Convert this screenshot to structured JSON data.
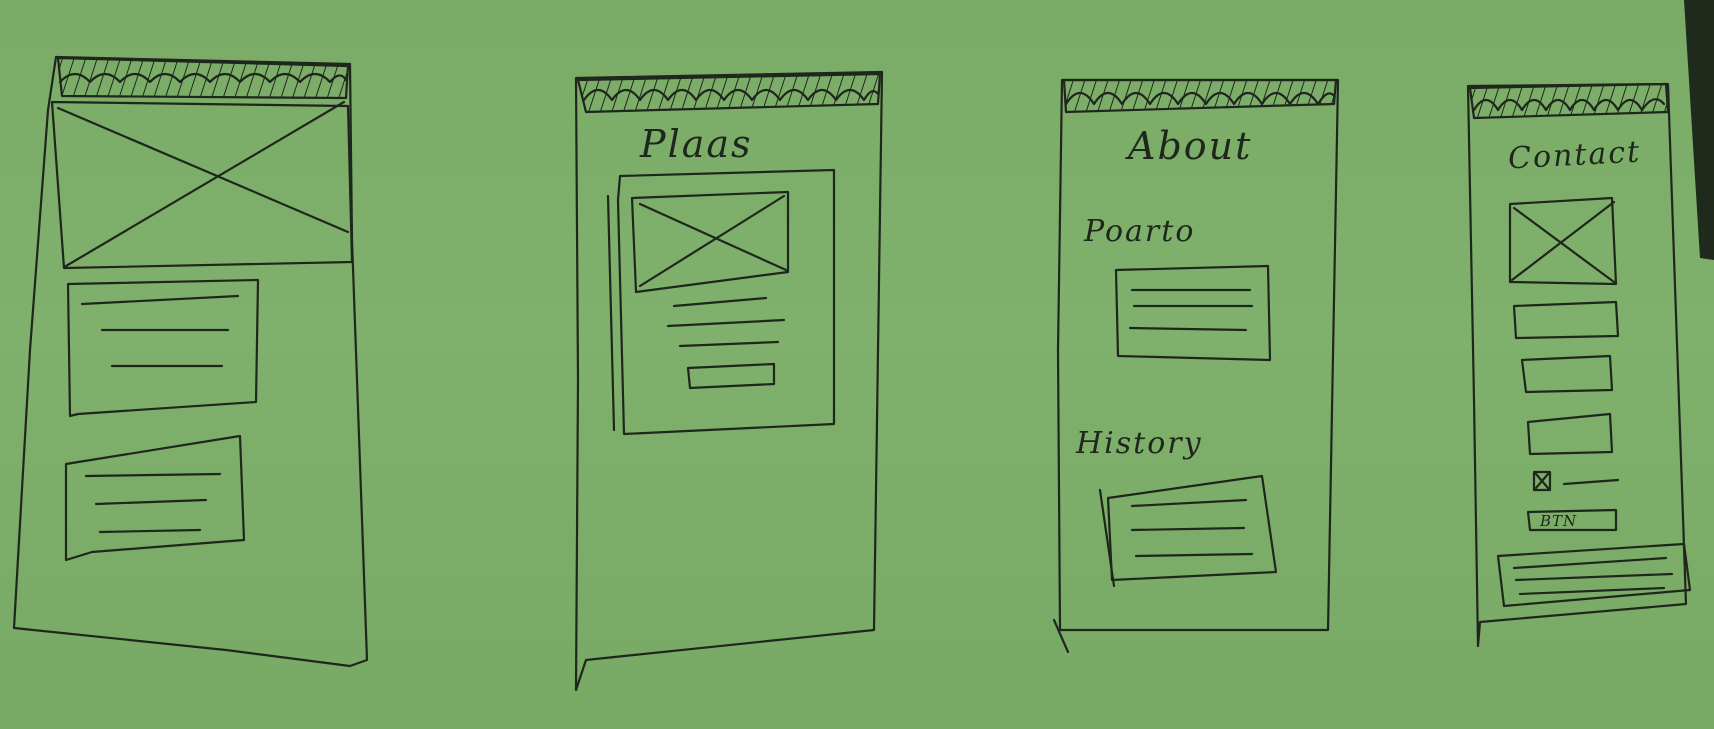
{
  "screens": [
    {
      "id": "home",
      "title": "",
      "elements": [
        "header-bar",
        "hero-image-placeholder",
        "text-card",
        "text-card"
      ]
    },
    {
      "id": "places",
      "title": "Plaas",
      "elements": [
        "header-bar",
        "card-with-image",
        "button"
      ]
    },
    {
      "id": "about",
      "title": "About",
      "sections": [
        "Poarto",
        "History"
      ],
      "elements": [
        "header-bar",
        "text-card",
        "text-card"
      ]
    },
    {
      "id": "contact",
      "title": "Contact",
      "button_label": "BTN",
      "elements": [
        "header-bar",
        "image-placeholder",
        "input",
        "input",
        "input",
        "checkbox",
        "button",
        "footer"
      ]
    }
  ],
  "ink_color": "#1f261c",
  "paper_color": "#7aac68"
}
